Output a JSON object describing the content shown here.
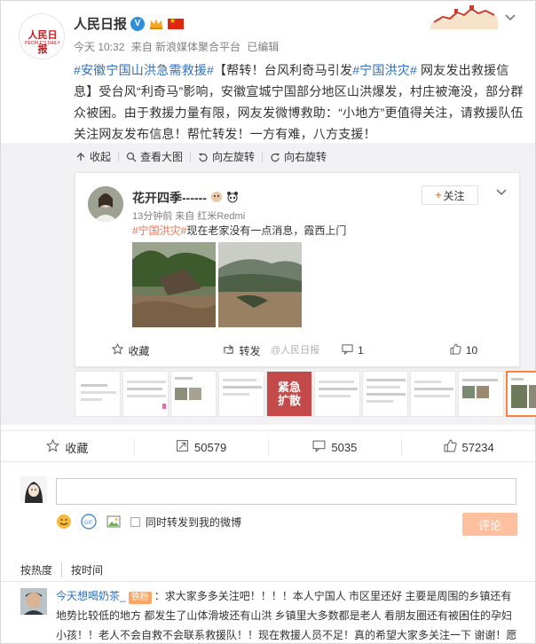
{
  "post": {
    "author": "人民日报",
    "logo_text": "人民日报",
    "logo_sub": "PEOPLE'S DAILY",
    "time": "今天 10:32",
    "source": "来自 新浪媒体聚合平台",
    "edited": "已编辑",
    "text_parts": {
      "tag1": "#安徽宁国山洪急需救援#",
      "body1": "【帮转！台风利奇马引发",
      "tag2": "#宁国洪灾#",
      "body2": " 网友发出救援信息】受台风“利奇马”影响，安徽宣城宁国部分地区山洪爆发，村庄被淹没，部分群众被困。由于救援力量有限，网友发微博救助：“小地方”更值得关注，请救援队伍关注网友发布信息！帮忙转发！一方有难，八方支援！"
    }
  },
  "toolbar": {
    "collapse": "收起",
    "view_large": "查看大图",
    "rotate_left": "向左旋转",
    "rotate_right": "向右旋转"
  },
  "inner": {
    "name": "花开四季------",
    "follow": "关注",
    "meta": "13分钟前 来自 红米Redmi",
    "tag": "#宁国洪灾#",
    "text": "现在老家没有一点消息，霞西上门",
    "fav": "收藏",
    "repost": "转发",
    "comments": "1",
    "likes": "10",
    "watermark": "@人民日报"
  },
  "thumb_red_text": "紧急\n扩散",
  "actions": {
    "fav": "收藏",
    "reposts": "50579",
    "comments": "5035",
    "likes": "57234"
  },
  "composer": {
    "also_repost": "同时转发到我的微博",
    "submit": "评论"
  },
  "sort": {
    "hot": "按热度",
    "time": "按时间"
  },
  "comment": {
    "user": "今天想喝奶茶_",
    "badge": "铁粉",
    "text": "：求大家多多关注吧！！！！本人宁国人 市区里还好 主要是周围的乡镇还有地势比较低的地方 都发生了山体滑坡还有山洪 乡镇里大多数都是老人 看朋友圈还有被困住的孕妇小孩！！老人不会自救不会联系救援队！！现在救援人员不足！真的希望大家多关注一下 谢谢！愿"
  },
  "colors": {
    "link_orange": "#eb7350",
    "link_blue": "#2e6fc2",
    "repost_bg": "#f2f2f5",
    "submit_btn": "#ffc09f"
  }
}
